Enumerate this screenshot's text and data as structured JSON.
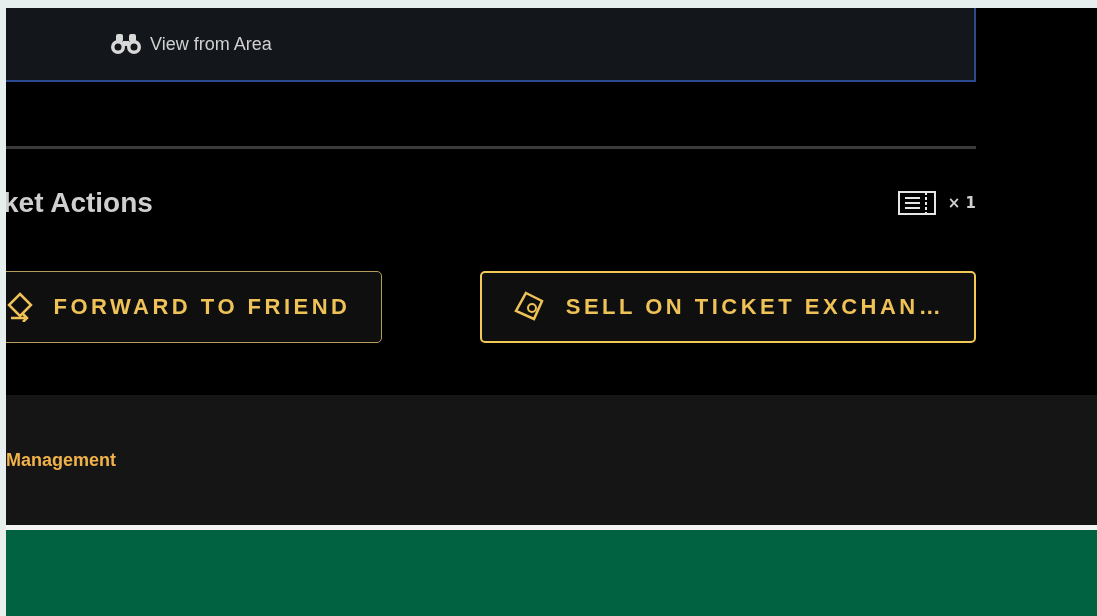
{
  "area_view": {
    "label": "View from Area"
  },
  "ticket_actions": {
    "title": "ket Actions",
    "count": "× 1",
    "buttons": [
      {
        "kind": "forward",
        "label": "FORWARD TO FRIEND",
        "focused": false
      },
      {
        "kind": "sell",
        "label": "SELL ON TICKET EXCHAN…",
        "focused": true
      }
    ]
  },
  "footer": {
    "link": "Management"
  }
}
